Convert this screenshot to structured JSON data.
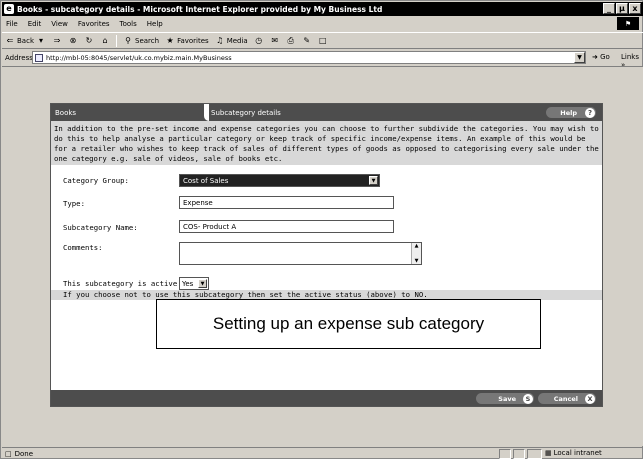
{
  "window": {
    "title": "Books - subcategory details - Microsoft Internet Explorer provided by My Business Ltd",
    "controls": [
      "_",
      "µ",
      "x"
    ]
  },
  "menu": [
    "File",
    "Edit",
    "View",
    "Favorites",
    "Tools",
    "Help"
  ],
  "toolbar": {
    "back": "Back",
    "search": "Search",
    "favorites": "Favorites",
    "media": "Media"
  },
  "address": {
    "label": "Address",
    "url": "http://mbl-05:8045/servlet/uk.co.mybiz.main.MyBusiness",
    "go": "Go",
    "links": "Links"
  },
  "panel": {
    "tab_books": "Books",
    "tab_subcategory": "Subcategory details",
    "help_label": "Help",
    "help_icon": "?",
    "intro": "In addition to the pre-set income and expense categories you can choose to further subdivide the categories. You may wish to do this to help analyse a particular category or keep track of specific income/expense items. An example of this would be for a retailer who wishes to keep track of sales of different types of goods as opposed to categorising every sale under the one category e.g. sale of videos, sale of books etc.",
    "fields": {
      "category_group_label": "Category Group:",
      "category_group_value": "Cost of Sales",
      "type_label": "Type:",
      "type_value": "Expense",
      "subcategory_name_label": "Subcategory Name:",
      "subcategory_name_value": "COS- Product A",
      "comments_label": "Comments:",
      "comments_value": "",
      "active_label": "This subcategory is active:",
      "active_value": "Yes"
    },
    "info": "If you choose not to use this subcategory then set the active status (above) to NO.",
    "save_label": "Save",
    "save_icon": "S",
    "cancel_label": "Cancel",
    "cancel_icon": "X"
  },
  "callout": "Setting up an expense sub category",
  "status": {
    "text": "Done",
    "zone": "Local intranet"
  }
}
